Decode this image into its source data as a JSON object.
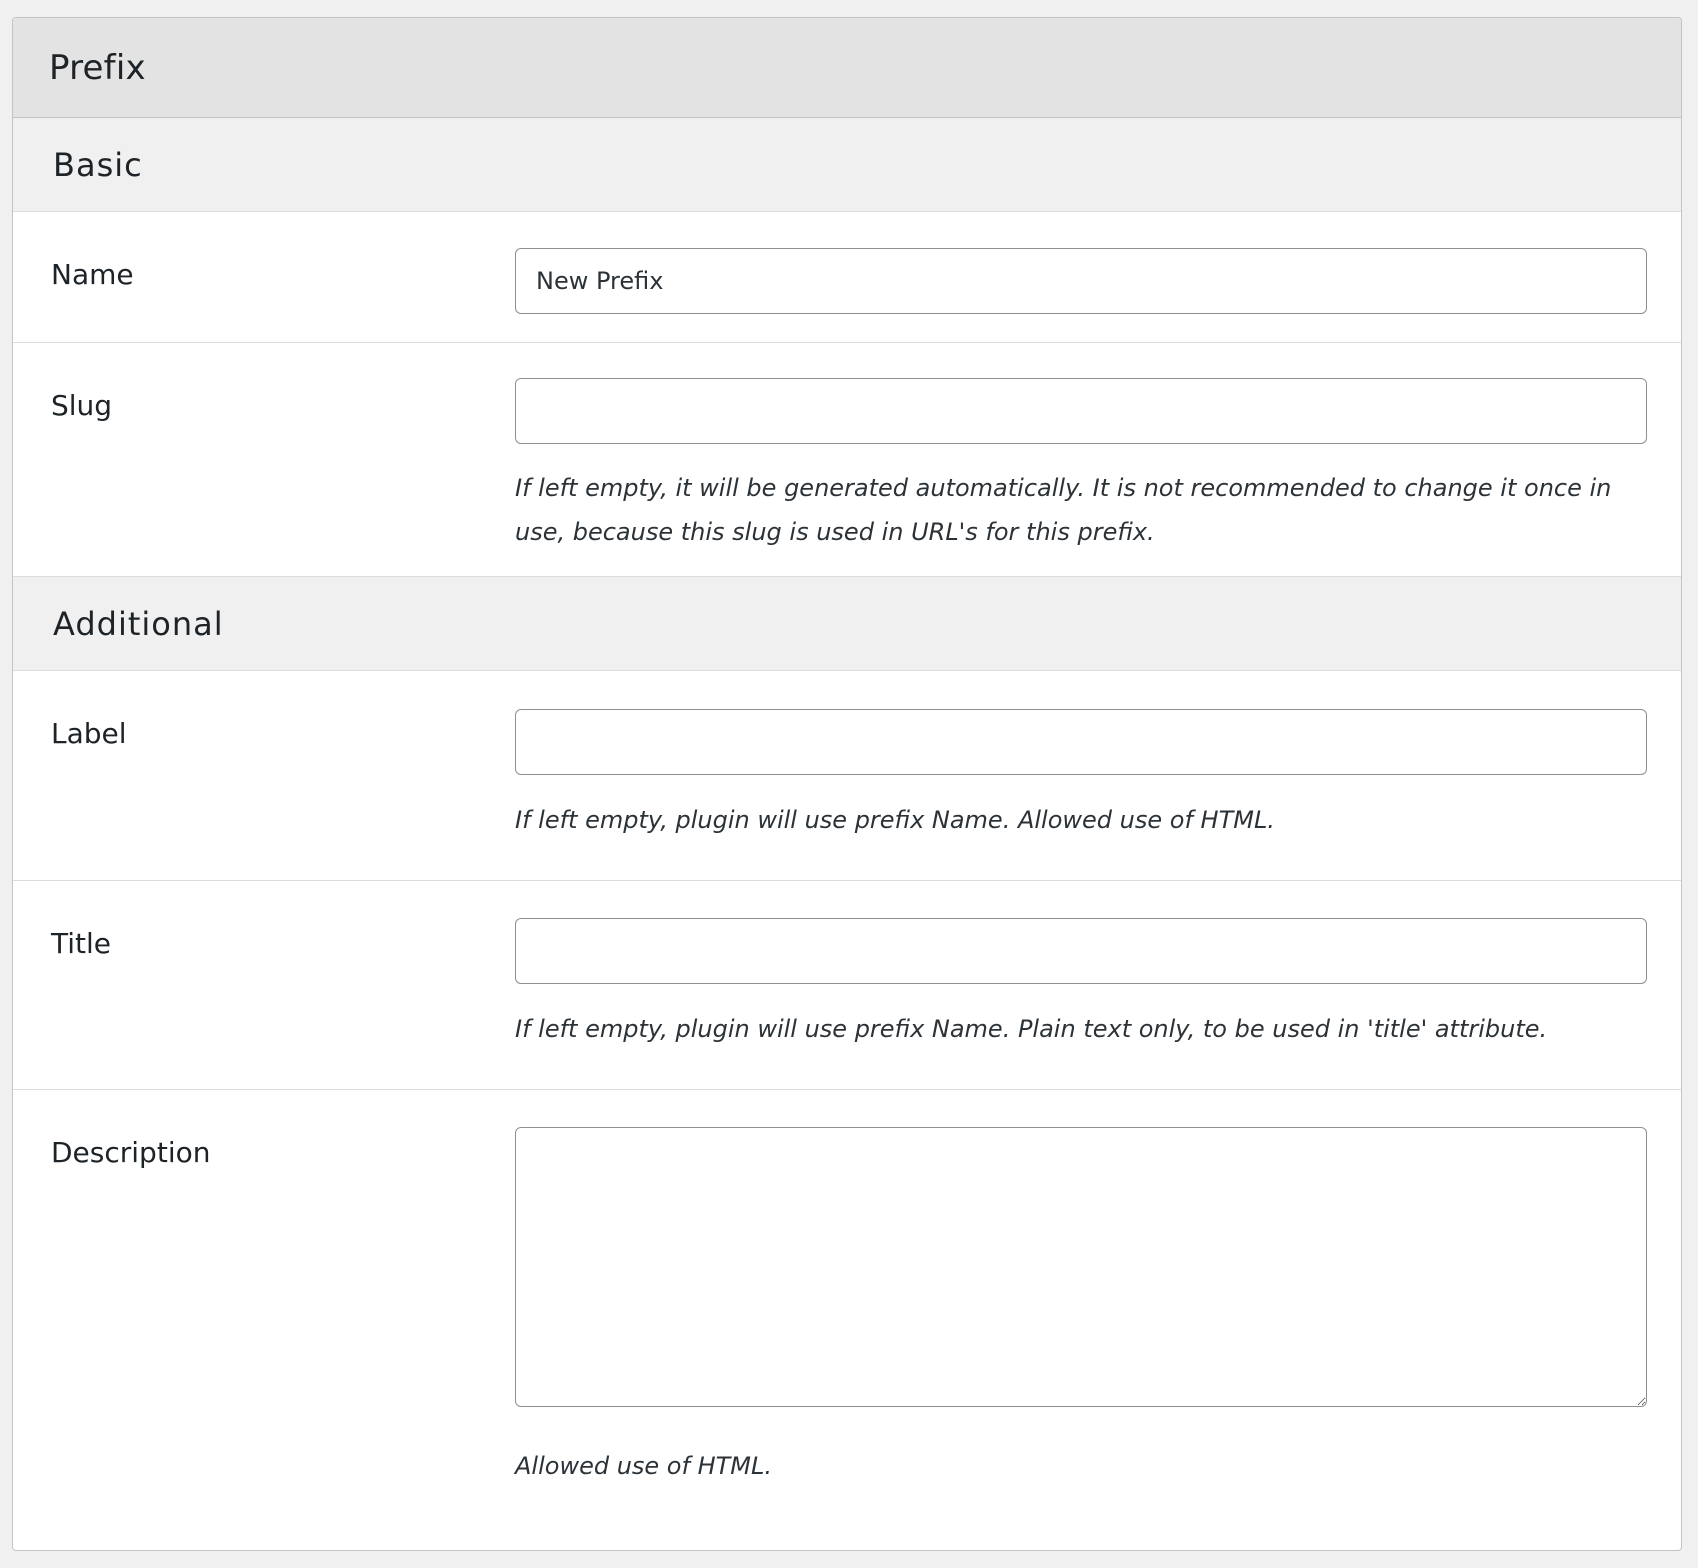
{
  "panel": {
    "title": "Prefix"
  },
  "sections": {
    "basic": {
      "title": "Basic",
      "name": {
        "label": "Name",
        "value": "New Prefix"
      },
      "slug": {
        "label": "Slug",
        "value": "",
        "help": "If left empty, it will be generated automatically. It is not recommended to change it once in use, because this slug is used in URL's for this prefix."
      }
    },
    "additional": {
      "title": "Additional",
      "label": {
        "label": "Label",
        "value": "",
        "help": "If left empty, plugin will use prefix Name. Allowed use of HTML."
      },
      "title_field": {
        "label": "Title",
        "value": "",
        "help": "If left empty, plugin will use prefix Name. Plain text only, to be used in 'title' attribute."
      },
      "description": {
        "label": "Description",
        "value": "",
        "help": "Allowed use of HTML."
      }
    }
  }
}
